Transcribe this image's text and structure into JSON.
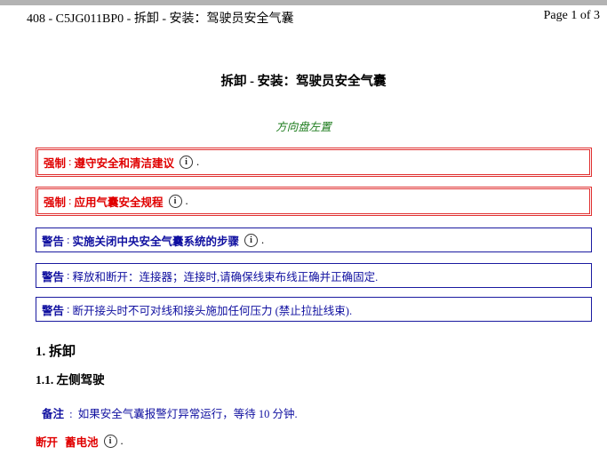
{
  "header": {
    "doc_ref": "408 - C5JG011BP0 - 拆卸 - 安装：驾驶员安全气囊",
    "page": "Page 1 of 3"
  },
  "title": "拆卸 - 安装：驾驶员安全气囊",
  "subtitle": "方向盘左置",
  "notices": [
    {
      "keyword": "强制",
      "separator": ":",
      "text": "遵守安全和清洁建议",
      "icon": "info-icon",
      "tail": "."
    },
    {
      "keyword": "强制",
      "separator": ":",
      "text": "应用气囊安全规程",
      "icon": "info-icon",
      "tail": "."
    },
    {
      "keyword": "警告",
      "separator": ":",
      "text": "实施关闭中央安全气囊系统的步骤",
      "icon": "info-icon",
      "tail": "."
    },
    {
      "keyword": "警告",
      "separator": ":",
      "text": "释放和断开：连接器；连接时,请确保线束布线正确并正确固定."
    },
    {
      "keyword": "警告",
      "separator": ":",
      "text": "断开接头时不可对线和接头施加任何压力 (禁止拉扯线束)."
    }
  ],
  "section": {
    "heading": "1. 拆卸",
    "subheading": "1.1. 左侧驾驶",
    "note_keyword": "备注",
    "note_separator": ":",
    "note_text": "如果安全气囊报警灯异常运行，等待 10 分钟.",
    "action_verb": "断开",
    "action_object": "蓄电池",
    "action_tail": "."
  },
  "colors": {
    "mandatory": "#e00000",
    "warning": "#1010a0",
    "subtitle": "#1a7a1a"
  }
}
